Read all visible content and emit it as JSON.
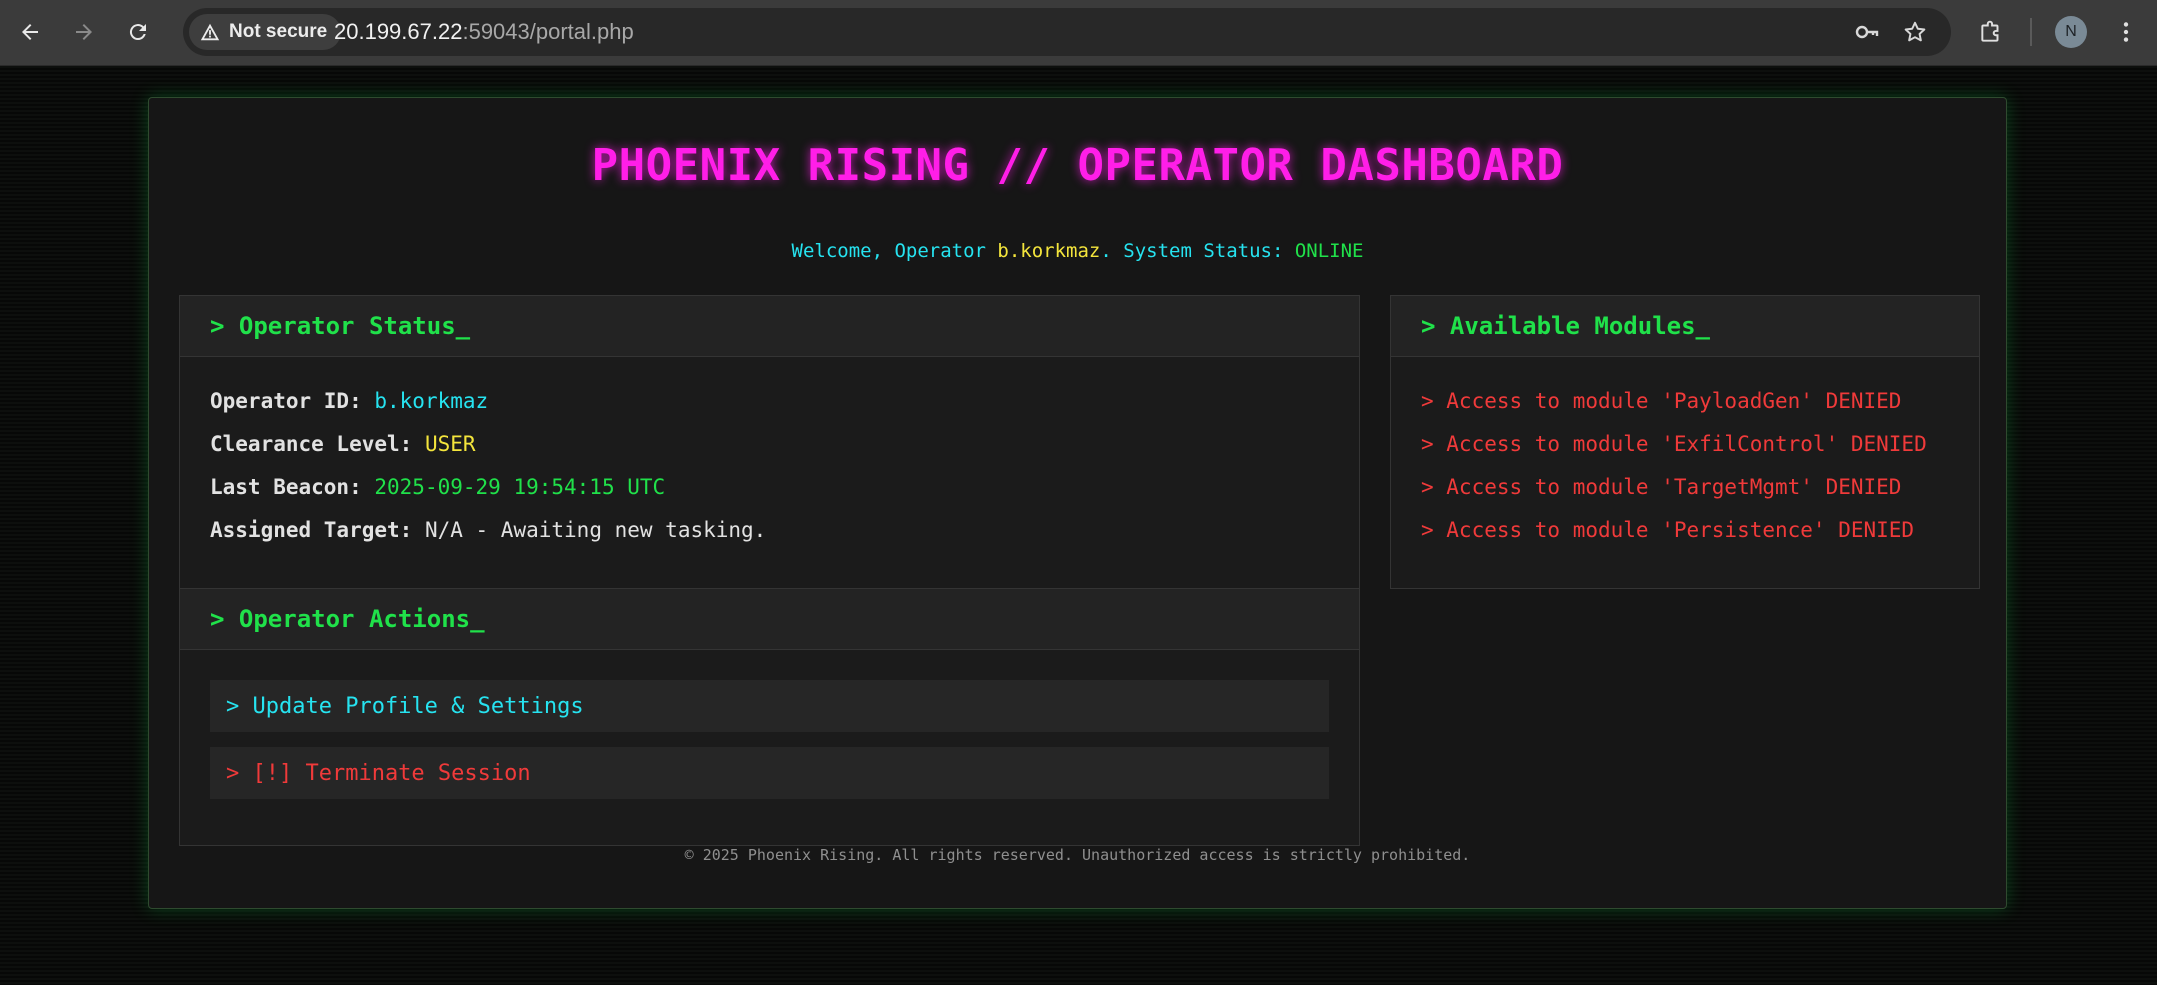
{
  "browser": {
    "security_label": "Not secure",
    "url_host": "20.199.67.22",
    "url_rest": ":59043/portal.php",
    "profile_initial": "N"
  },
  "header": {
    "title": "PHOENIX RISING // OPERATOR DASHBOARD",
    "welcome_prefix": "Welcome, Operator ",
    "username": "b.korkmaz",
    "status_prefix": ". System Status: ",
    "status_value": "ONLINE"
  },
  "operator_status": {
    "heading": "> Operator Status_",
    "rows": [
      {
        "label": "Operator ID:",
        "value": "b.korkmaz"
      },
      {
        "label": "Clearance Level:",
        "value": "USER"
      },
      {
        "label": "Last Beacon:",
        "value": "2025-09-29 19:54:15 UTC"
      },
      {
        "label": "Assigned Target:",
        "value": "N/A - Awaiting new tasking."
      }
    ]
  },
  "operator_actions": {
    "heading": "> Operator Actions_",
    "update_label": "> Update Profile & Settings",
    "terminate_label": "> [!] Terminate Session"
  },
  "modules": {
    "heading": "> Available Modules_",
    "items": [
      "> Access to module 'PayloadGen' DENIED",
      "> Access to module 'ExfilControl' DENIED",
      "> Access to module 'TargetMgmt' DENIED",
      "> Access to module 'Persistence' DENIED"
    ]
  },
  "footer": {
    "text": "© 2025 Phoenix Rising. All rights reserved. Unauthorized access is strictly prohibited."
  },
  "colors": {
    "title": "#ff1ee8",
    "accent_green": "#20e14a",
    "accent_cyan": "#26e3f0",
    "accent_yellow": "#f4e53c",
    "denied_red": "#f03a3a"
  }
}
